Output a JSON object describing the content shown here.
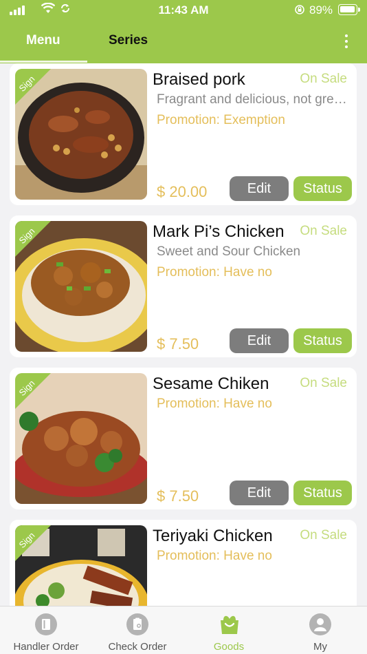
{
  "status_bar": {
    "time": "11:43 AM",
    "battery": "89%"
  },
  "header": {
    "tabs": [
      {
        "label": "Menu",
        "active": true
      },
      {
        "label": "Series",
        "active": false
      }
    ],
    "more_icon": "more-vertical-icon"
  },
  "ribbon_label": "Sign",
  "buttons": {
    "edit": "Edit",
    "status": "Status"
  },
  "items": [
    {
      "name": "Braised pork",
      "status": "On Sale",
      "description": "Fragrant and delicious, not greasy",
      "promotion": "Promotion: Exemption",
      "price": "$ 20.00"
    },
    {
      "name": "Mark Pi’s Chicken",
      "status": "On Sale",
      "description": "Sweet and Sour Chicken",
      "promotion": "Promotion: Have no",
      "price": "$ 7.50"
    },
    {
      "name": "Sesame Chiken",
      "status": "On Sale",
      "description": "",
      "promotion": "Promotion: Have no",
      "price": "$ 7.50"
    },
    {
      "name": "Teriyaki Chicken",
      "status": "On Sale",
      "description": "",
      "promotion": "Promotion: Have no",
      "price": ""
    }
  ],
  "bottom_nav": [
    {
      "label": "Handler Order",
      "icon": "document-icon",
      "active": false
    },
    {
      "label": "Check Order",
      "icon": "clipboard-icon",
      "active": false
    },
    {
      "label": "Goods",
      "icon": "shopping-bag-icon",
      "active": true
    },
    {
      "label": "My",
      "icon": "user-icon",
      "active": false
    }
  ],
  "colors": {
    "accent": "#9cc84b",
    "price": "#e4be5a",
    "sale": "#c5dc7e",
    "edit_button": "#7d7d7d"
  }
}
